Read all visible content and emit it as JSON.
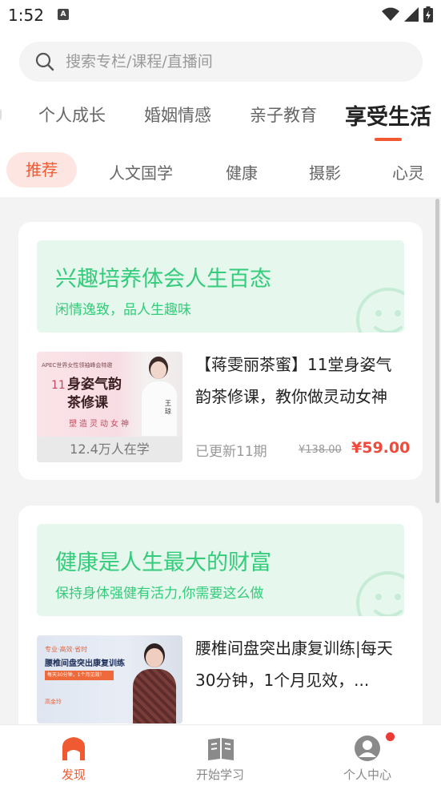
{
  "status": {
    "time": "1:52"
  },
  "search": {
    "placeholder": "搜索专栏/课程/直播间"
  },
  "categories": [
    "个人成长",
    "婚姻情感",
    "亲子教育",
    "享受生活"
  ],
  "active_category": "享受生活",
  "subtabs": [
    "推荐",
    "人文国学",
    "健康",
    "摄影",
    "心灵"
  ],
  "sections": [
    {
      "banner_title": "兴趣培养体会人生百态",
      "banner_subtitle": "闲情逸致，品人生趣味",
      "course": {
        "title": "【蒋雯丽茶蜜】11堂身姿气韵茶修课，教你做灵动女神",
        "thumb_header": "APEC世界女性领袖峰会特邀",
        "thumb_main": "身姿气韵茶修课",
        "thumb_num": "11",
        "thumb_sub": "塑造灵动女神",
        "thumb_name": "王琼",
        "learners": "12.4万人在学",
        "updated": "已更新11期",
        "old_price": "¥138.00",
        "price": "¥59.00"
      }
    },
    {
      "banner_title": "健康是人生最大的财富",
      "banner_subtitle": "保持身体强健有活力,你需要这么做",
      "course": {
        "title": "腰椎间盘突出康复训练|每天30分钟，1个月见效，...",
        "thumb_header": "专业·高效·省时",
        "thumb_main": "腰椎间盘突出康复训练",
        "thumb_sub": "每天30分钟，1个月见效！",
        "thumb_name": "高金玲"
      }
    }
  ],
  "nav": [
    {
      "label": "发现",
      "icon": "discover-icon"
    },
    {
      "label": "开始学习",
      "icon": "book-icon"
    },
    {
      "label": "个人中心",
      "icon": "profile-icon"
    }
  ],
  "colors": {
    "accent": "#ef5a32",
    "banner_green": "#33cc7a",
    "price_red": "#ef4a3b"
  }
}
